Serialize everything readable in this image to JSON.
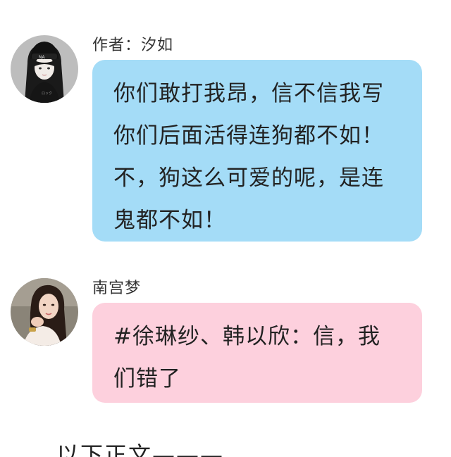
{
  "messages": [
    {
      "author": "作者：汐如",
      "avatar_icon": "girl-beanie-avatar-icon",
      "bubble_color": "#a4dcf7",
      "text": "你们敢打我昂，信不信我写你们后面活得连狗都不如！不，狗这么可爱的呢，是连鬼都不如！"
    },
    {
      "author": "南宫梦",
      "avatar_icon": "woman-portrait-avatar-icon",
      "bubble_color": "#fdd0dd",
      "text": "#徐琳纱、韩以欣：信，我们错了"
    }
  ],
  "footer": {
    "text": "以下正文———"
  }
}
